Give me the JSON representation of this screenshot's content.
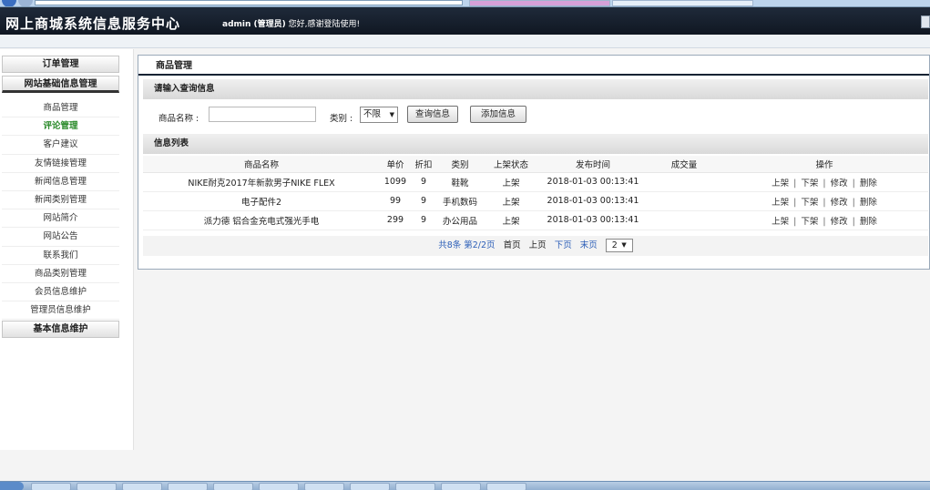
{
  "header": {
    "title": "网上商城系统信息服务中心",
    "user": "admin (管理员)",
    "welcome": "您好,感谢登陆使用!"
  },
  "sidebar": {
    "groups": [
      "订单管理",
      "网站基础信息管理",
      "基本信息维护"
    ],
    "items": [
      {
        "label": "商品管理"
      },
      {
        "label": "评论管理"
      },
      {
        "label": "客户建议"
      },
      {
        "label": "友情链接管理"
      },
      {
        "label": "新闻信息管理"
      },
      {
        "label": "新闻类别管理"
      },
      {
        "label": "网站简介"
      },
      {
        "label": "网站公告"
      },
      {
        "label": "联系我们"
      },
      {
        "label": "商品类别管理"
      },
      {
        "label": "会员信息维护"
      },
      {
        "label": "管理员信息维护"
      }
    ]
  },
  "main": {
    "heading": "商品管理",
    "query_section": "请输入查询信息",
    "name_label": "商品名称 :",
    "name_value": "",
    "category_label": "类别 :",
    "category_value": "不限",
    "query_button": "查询信息",
    "add_button": "添加信息",
    "list_section": "信息列表",
    "columns": [
      "商品名称",
      "单价",
      "折扣",
      "类别",
      "上架状态",
      "发布时间",
      "成交量",
      "操作"
    ],
    "rows": [
      {
        "name": "NIKE耐克2017年新款男子NIKE FLEX",
        "price": "1099",
        "discount": "9",
        "category": "鞋靴",
        "status": "上架",
        "time": "2018-01-03 00:13:41",
        "sales": ""
      },
      {
        "name": "电子配件2",
        "price": "99",
        "discount": "9",
        "category": "手机数码",
        "status": "上架",
        "time": "2018-01-03 00:13:41",
        "sales": ""
      },
      {
        "name": "派力德 铝合金充电式强光手电",
        "price": "299",
        "discount": "9",
        "category": "办公用品",
        "status": "上架",
        "time": "2018-01-03 00:13:41",
        "sales": ""
      }
    ],
    "ops": [
      "上架",
      "下架",
      "修改",
      "删除"
    ],
    "pager": {
      "summary": "共8条 第2/2页",
      "first": "首页",
      "prev": "上页",
      "next": "下页",
      "last": "末页",
      "page_select": "2"
    }
  }
}
